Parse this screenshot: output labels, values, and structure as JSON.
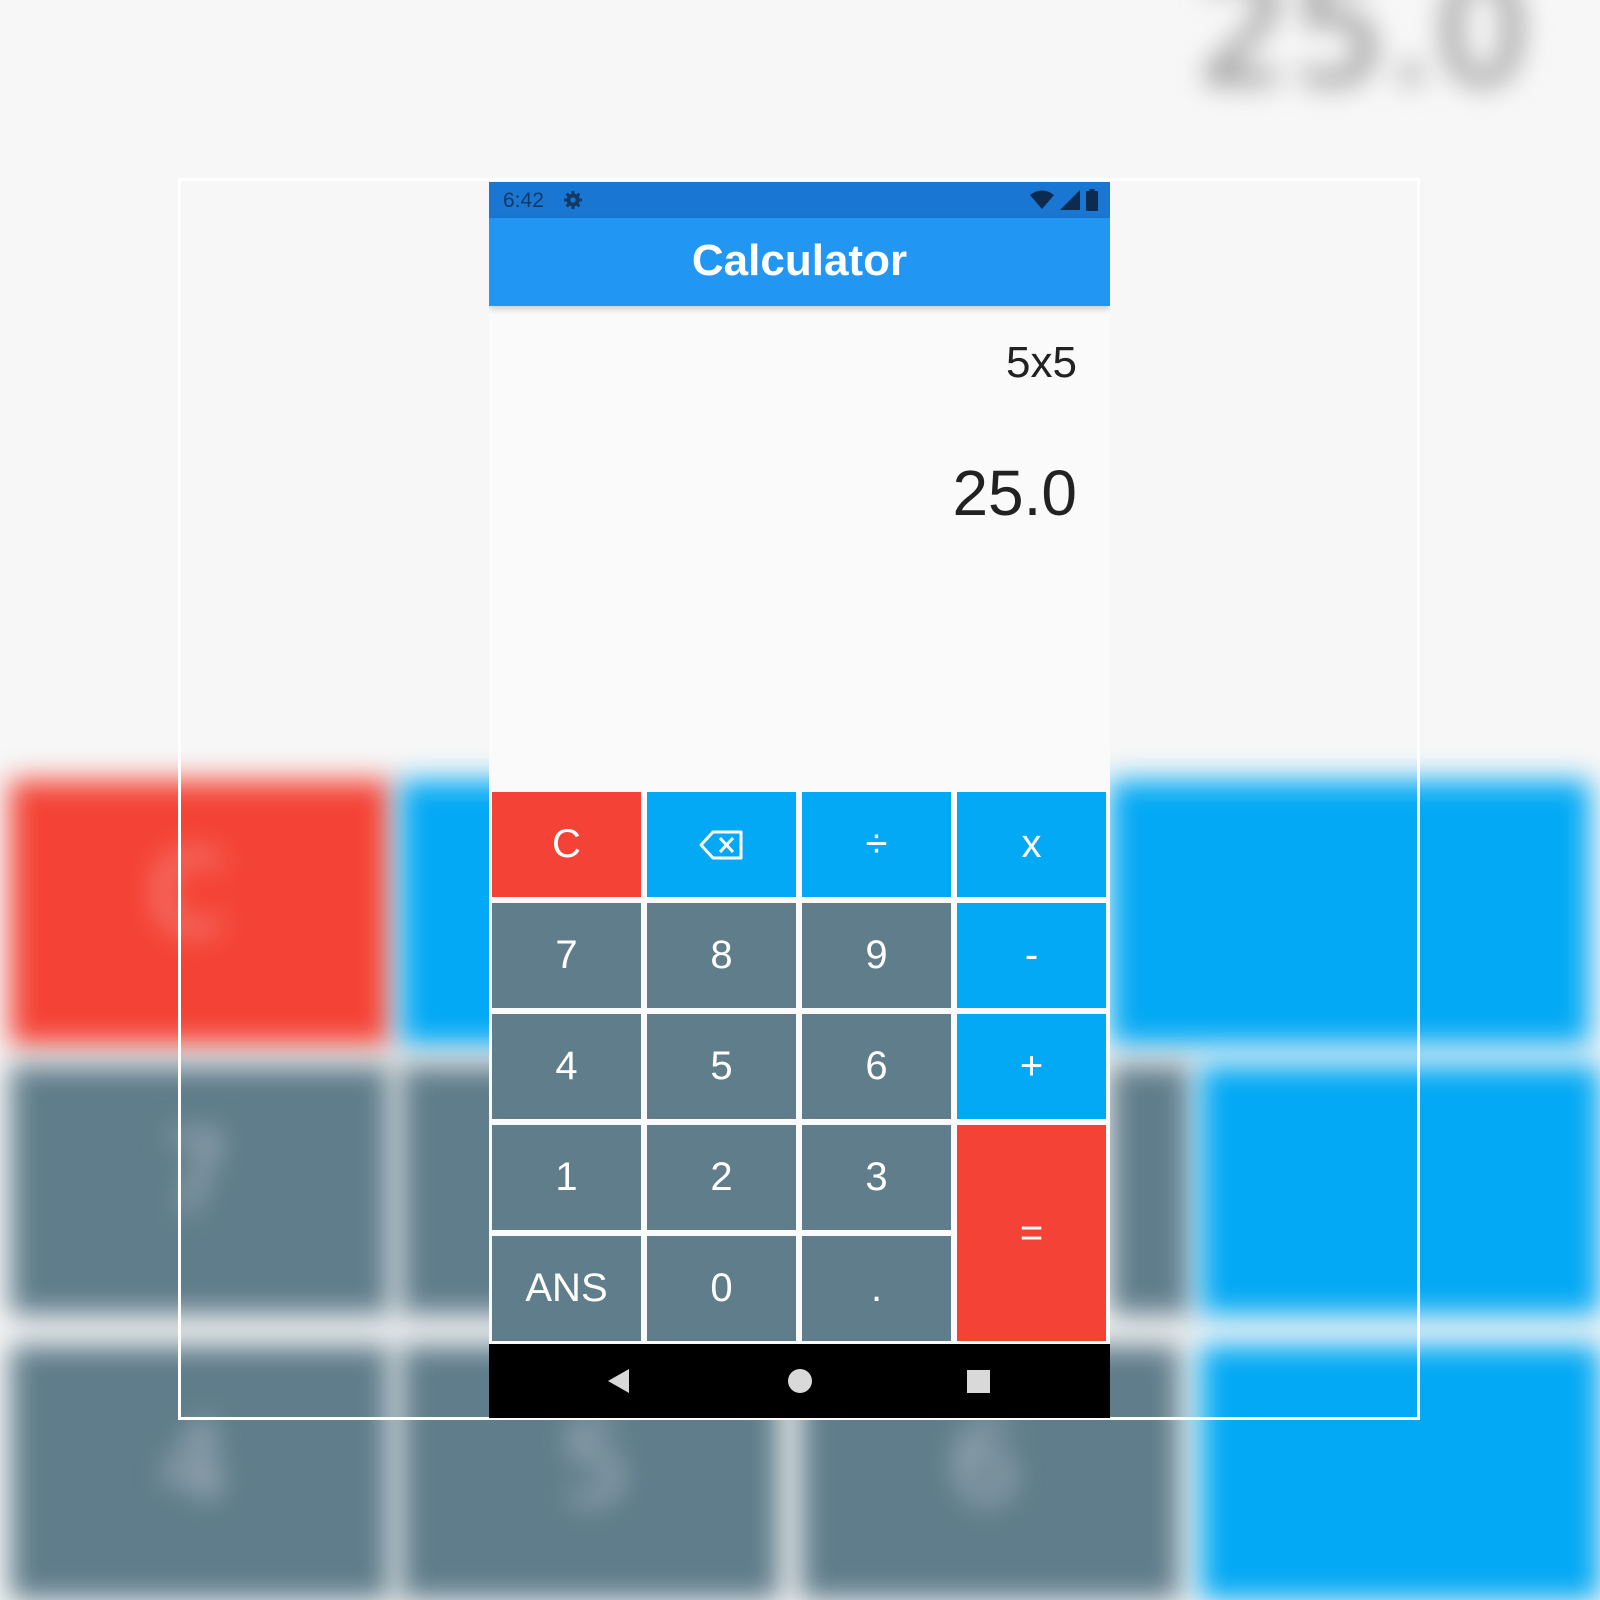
{
  "status_bar": {
    "time": "6:42"
  },
  "app_bar": {
    "title": "Calculator"
  },
  "display": {
    "expression": "5x5",
    "result": "25.0"
  },
  "keys": {
    "clear": "C",
    "backspace_icon": "backspace-icon",
    "divide": "÷",
    "multiply": "x",
    "seven": "7",
    "eight": "8",
    "nine": "9",
    "minus": "-",
    "four": "4",
    "five": "5",
    "six": "6",
    "plus": "+",
    "one": "1",
    "two": "2",
    "three": "3",
    "equals": "=",
    "ans": "ANS",
    "zero": "0",
    "dot": "."
  },
  "colors": {
    "status_bar": "#1976d2",
    "app_bar": "#2196f3",
    "digit_key": "#607d8b",
    "operator_key": "#03a9f4",
    "action_key": "#f44336"
  }
}
